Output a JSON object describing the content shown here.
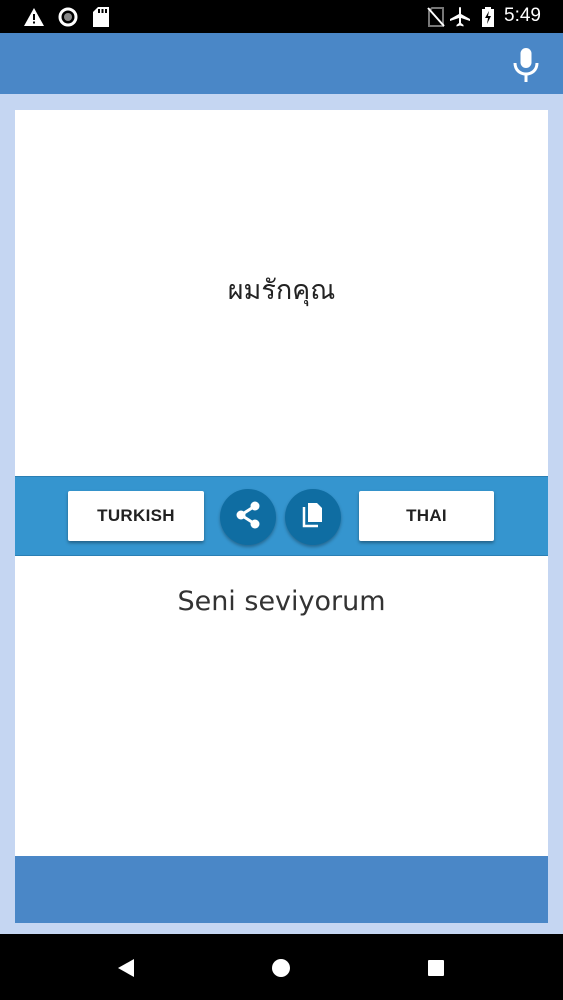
{
  "status_bar": {
    "time": "5:49",
    "left_icons": [
      "warning-icon",
      "sync-icon",
      "sd-card-icon"
    ],
    "right_icons": [
      "no-sim-icon",
      "airplane-icon",
      "battery-icon"
    ]
  },
  "app_bar": {
    "action_icon": "microphone-icon"
  },
  "source_text": "ผมรักคุณ",
  "toolbar": {
    "left_language": "TURKISH",
    "right_language": "THAI",
    "share_icon": "share-icon",
    "copy_icon": "copy-icon"
  },
  "translation_text": "Seni seviyorum",
  "nav_bar": {
    "back_icon": "back-icon",
    "home_icon": "home-icon",
    "recents_icon": "recents-icon"
  },
  "colors": {
    "app_bar": "#4a87c7",
    "toolbar": "#3595cf",
    "round_button": "#0f6da2",
    "background": "#c5d6f2"
  }
}
